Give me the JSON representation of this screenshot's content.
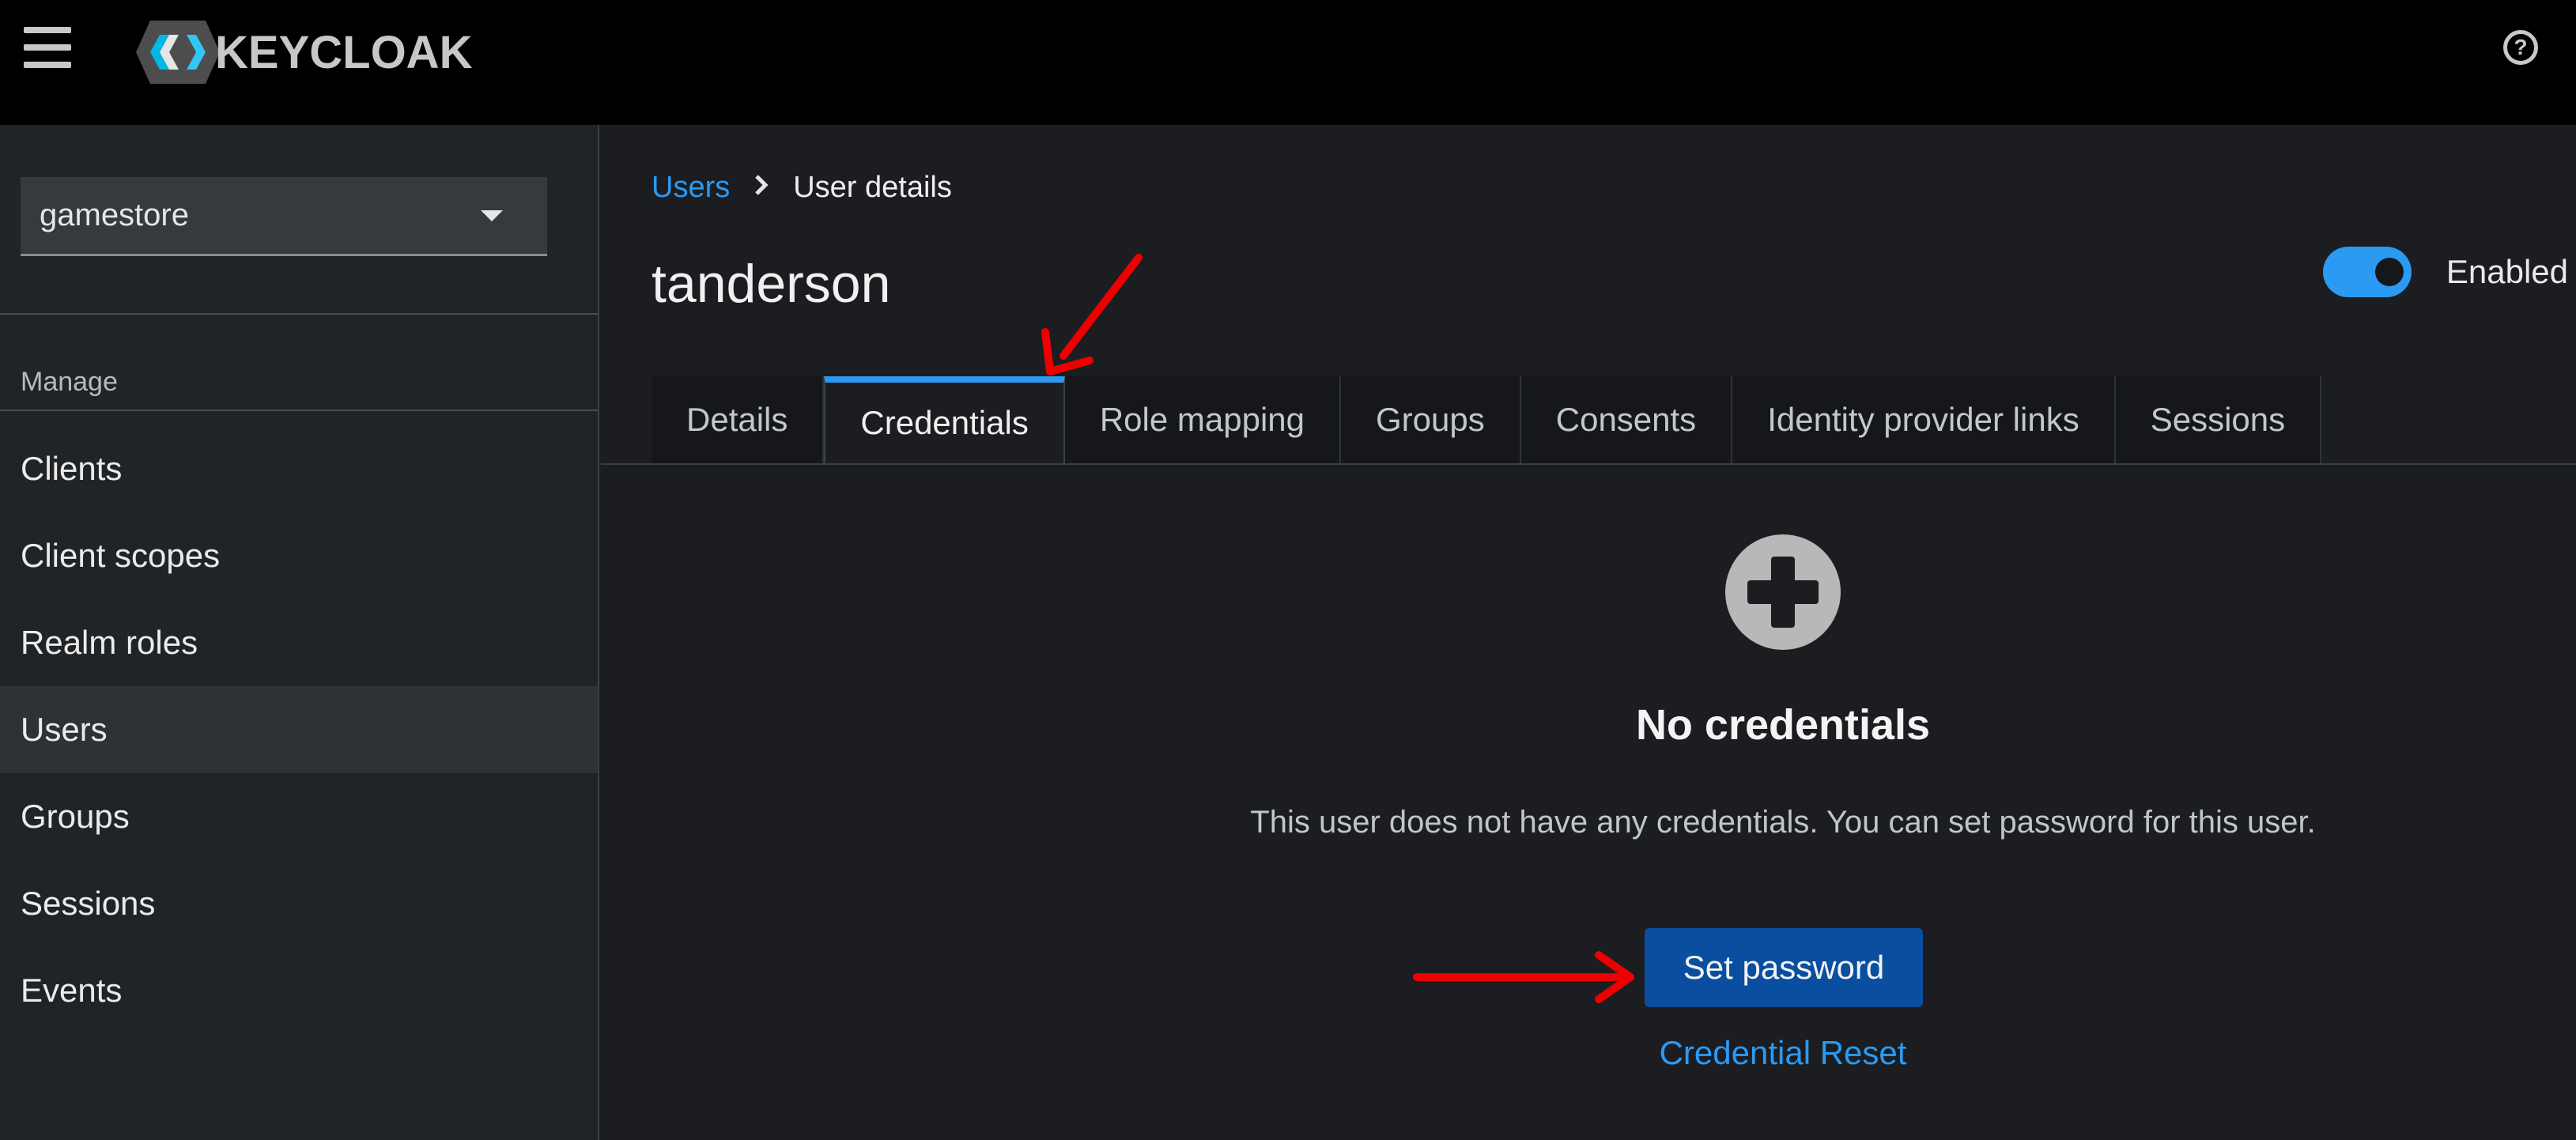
{
  "header": {
    "brand": "KEYCLOAK",
    "menu_icon": "hamburger-menu-icon",
    "help_icon": "help-circle-icon",
    "help_glyph": "?"
  },
  "sidebar": {
    "realm": "gamestore",
    "section": "Manage",
    "items": [
      {
        "label": "Clients"
      },
      {
        "label": "Client scopes"
      },
      {
        "label": "Realm roles"
      },
      {
        "label": "Users",
        "active": true
      },
      {
        "label": "Groups"
      },
      {
        "label": "Sessions"
      },
      {
        "label": "Events"
      }
    ]
  },
  "breadcrumb": {
    "parent": "Users",
    "current": "User details"
  },
  "page": {
    "title": "tanderson",
    "enabled_label": "Enabled",
    "enabled": true
  },
  "tabs": [
    {
      "label": "Details"
    },
    {
      "label": "Credentials",
      "active": true
    },
    {
      "label": "Role mapping"
    },
    {
      "label": "Groups"
    },
    {
      "label": "Consents"
    },
    {
      "label": "Identity provider links"
    },
    {
      "label": "Sessions"
    }
  ],
  "empty_state": {
    "icon": "plus-circle-icon",
    "title": "No credentials",
    "body": "This user does not have any credentials. You can set password for this user.",
    "primary_action": "Set password",
    "secondary_action": "Credential Reset"
  },
  "colors": {
    "accent": "#2b9af3",
    "primary_button": "#0a4ea0",
    "annotation_arrow": "#ee0000"
  }
}
